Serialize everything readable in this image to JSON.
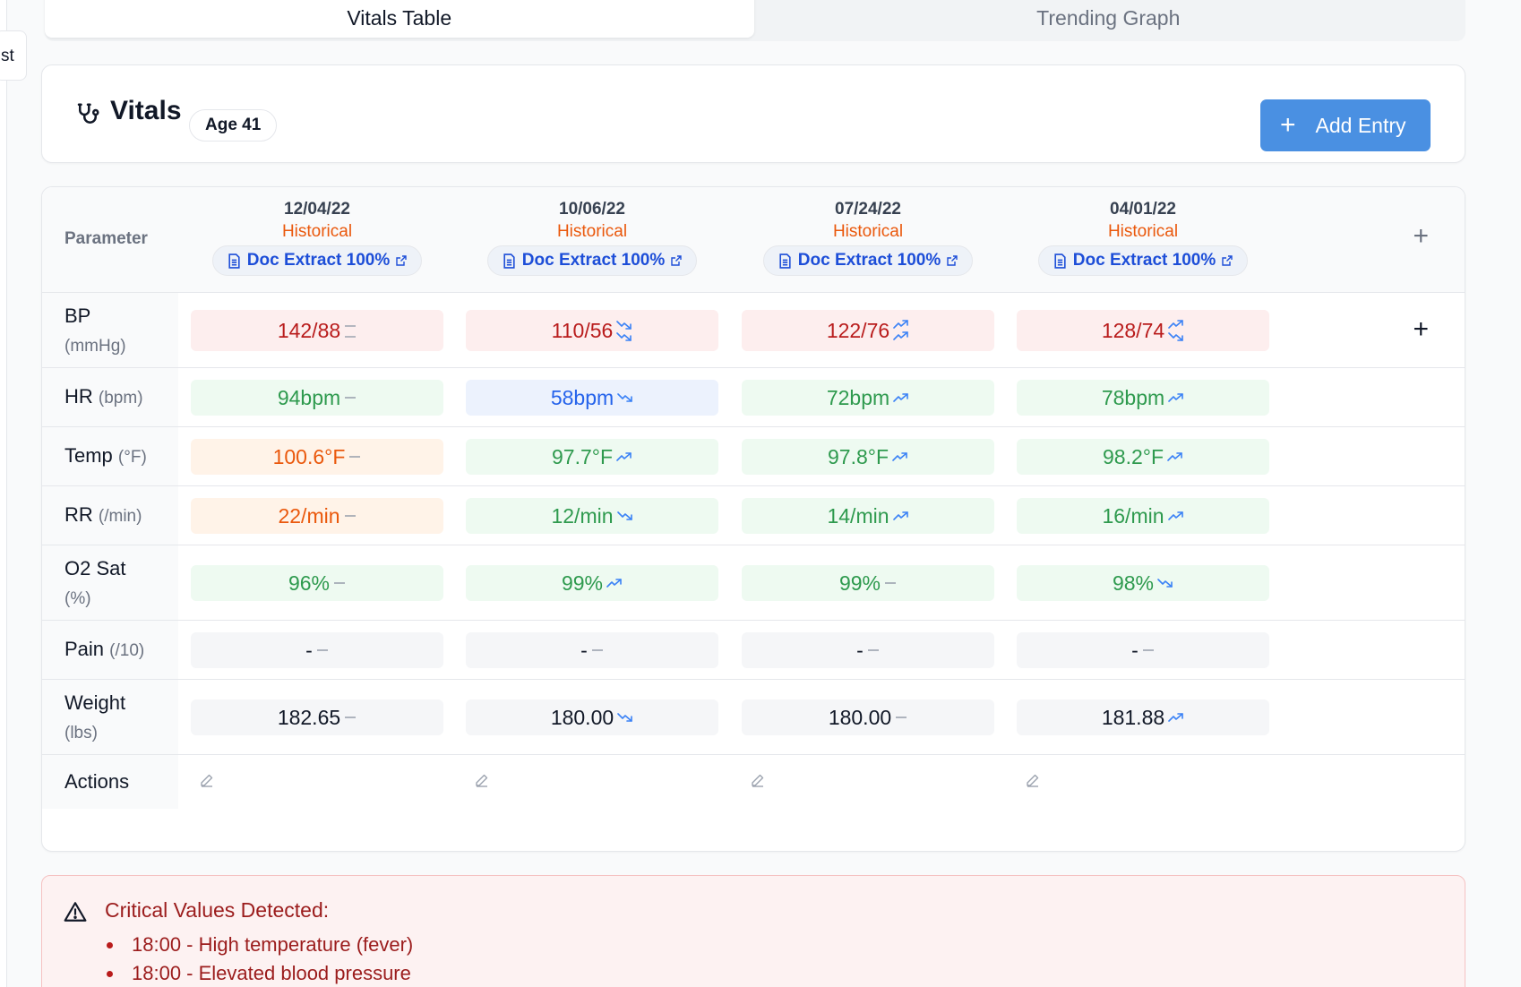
{
  "sidebar": {
    "tab_fragment": "st"
  },
  "tabs": [
    {
      "label": "Vitals Table",
      "active": true
    },
    {
      "label": "Trending Graph",
      "active": false
    }
  ],
  "header": {
    "title": "Vitals",
    "icon": "stethoscope-icon",
    "age_badge": "Age 41",
    "add_button": {
      "icon": "plus",
      "label": "Add Entry"
    }
  },
  "table": {
    "parameter_header": "Parameter",
    "add_column": "+",
    "columns": [
      {
        "date": "12/04/22",
        "status": "Historical",
        "source": "Doc Extract 100%"
      },
      {
        "date": "10/06/22",
        "status": "Historical",
        "source": "Doc Extract 100%"
      },
      {
        "date": "07/24/22",
        "status": "Historical",
        "source": "Doc Extract 100%"
      },
      {
        "date": "04/01/22",
        "status": "Historical",
        "source": "Doc Extract 100%"
      }
    ],
    "rows": [
      {
        "name": "BP",
        "unit": "(mmHg)",
        "add": "+",
        "values": [
          {
            "value": "142/88",
            "tone": "red",
            "trend": "stable"
          },
          {
            "value": "110/56",
            "tone": "red",
            "trend": "down"
          },
          {
            "value": "122/76",
            "tone": "red",
            "trend": "up"
          },
          {
            "value": "128/74",
            "tone": "red",
            "trend": "mixed"
          }
        ]
      },
      {
        "name": "HR",
        "unit": "(bpm)",
        "values": [
          {
            "value": "94bpm",
            "tone": "green",
            "trend": "stable"
          },
          {
            "value": "58bpm",
            "tone": "blue",
            "trend": "down"
          },
          {
            "value": "72bpm",
            "tone": "green",
            "trend": "up"
          },
          {
            "value": "78bpm",
            "tone": "green",
            "trend": "up"
          }
        ]
      },
      {
        "name": "Temp",
        "unit": "(°F)",
        "values": [
          {
            "value": "100.6°F",
            "tone": "orange",
            "trend": "stable"
          },
          {
            "value": "97.7°F",
            "tone": "green",
            "trend": "up"
          },
          {
            "value": "97.8°F",
            "tone": "green",
            "trend": "up"
          },
          {
            "value": "98.2°F",
            "tone": "green",
            "trend": "up"
          }
        ]
      },
      {
        "name": "RR",
        "unit": "(/min)",
        "values": [
          {
            "value": "22/min",
            "tone": "orange",
            "trend": "stable"
          },
          {
            "value": "12/min",
            "tone": "green",
            "trend": "down"
          },
          {
            "value": "14/min",
            "tone": "green",
            "trend": "up"
          },
          {
            "value": "16/min",
            "tone": "green",
            "trend": "up"
          }
        ]
      },
      {
        "name": "O2 Sat",
        "unit": "(%)",
        "values": [
          {
            "value": "96%",
            "tone": "green",
            "trend": "stable"
          },
          {
            "value": "99%",
            "tone": "green",
            "trend": "up"
          },
          {
            "value": "99%",
            "tone": "green",
            "trend": "stable"
          },
          {
            "value": "98%",
            "tone": "green",
            "trend": "down"
          }
        ]
      },
      {
        "name": "Pain",
        "unit": "(/10)",
        "values": [
          {
            "value": "-",
            "tone": "gray",
            "trend": "stable"
          },
          {
            "value": "-",
            "tone": "gray",
            "trend": "stable"
          },
          {
            "value": "-",
            "tone": "gray",
            "trend": "stable"
          },
          {
            "value": "-",
            "tone": "gray",
            "trend": "stable"
          }
        ]
      },
      {
        "name": "Weight",
        "unit": "(lbs)",
        "values": [
          {
            "value": "182.65",
            "tone": "gray",
            "trend": "stable"
          },
          {
            "value": "180.00",
            "tone": "gray",
            "trend": "down"
          },
          {
            "value": "180.00",
            "tone": "gray",
            "trend": "stable"
          },
          {
            "value": "181.88",
            "tone": "gray",
            "trend": "up"
          }
        ]
      }
    ],
    "actions_label": "Actions",
    "action_icon": "pencil-icon"
  },
  "alert": {
    "icon": "warning-triangle-icon",
    "title": "Critical Values Detected:",
    "items": [
      "18:00 - High temperature (fever)",
      "18:00 - Elevated blood pressure"
    ]
  },
  "colors": {
    "primary": "#4a90e2",
    "historical": "#ea580c",
    "doc_link": "#1d4ed8",
    "critical_text": "#9b1c1c",
    "normal_text": "#2e9a4e",
    "low_text": "#2563eb",
    "high_text": "#b91c1c"
  }
}
